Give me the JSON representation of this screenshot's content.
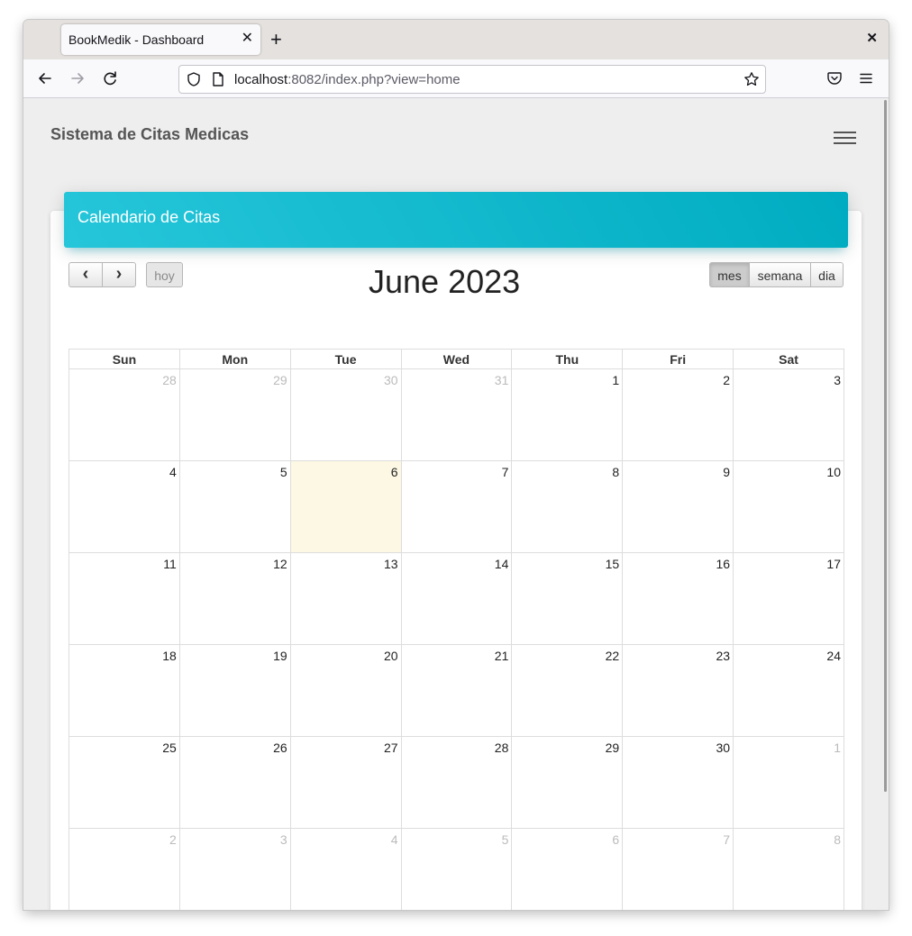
{
  "browser": {
    "tab_title": "BookMedik - Dashboard",
    "tab_close": "✕",
    "new_tab": "+",
    "window_close": "✕",
    "url_host": "localhost",
    "url_rest": ":8082/index.php?view=home"
  },
  "app": {
    "brand": "Sistema de Citas Medicas"
  },
  "card": {
    "title": "Calendario de Citas"
  },
  "calendar": {
    "prev_label": "‹",
    "next_label": "›",
    "today_label": "hoy",
    "title": "June 2023",
    "views": [
      "mes",
      "semana",
      "dia"
    ],
    "active_view": "mes",
    "weekdays": [
      "Sun",
      "Mon",
      "Tue",
      "Wed",
      "Thu",
      "Fri",
      "Sat"
    ],
    "today": "6",
    "weeks": [
      [
        {
          "d": "28",
          "o": true
        },
        {
          "d": "29",
          "o": true
        },
        {
          "d": "30",
          "o": true
        },
        {
          "d": "31",
          "o": true
        },
        {
          "d": "1"
        },
        {
          "d": "2"
        },
        {
          "d": "3"
        }
      ],
      [
        {
          "d": "4"
        },
        {
          "d": "5"
        },
        {
          "d": "6",
          "t": true
        },
        {
          "d": "7"
        },
        {
          "d": "8"
        },
        {
          "d": "9"
        },
        {
          "d": "10"
        }
      ],
      [
        {
          "d": "11"
        },
        {
          "d": "12"
        },
        {
          "d": "13"
        },
        {
          "d": "14"
        },
        {
          "d": "15"
        },
        {
          "d": "16"
        },
        {
          "d": "17"
        }
      ],
      [
        {
          "d": "18"
        },
        {
          "d": "19"
        },
        {
          "d": "20"
        },
        {
          "d": "21"
        },
        {
          "d": "22"
        },
        {
          "d": "23"
        },
        {
          "d": "24"
        }
      ],
      [
        {
          "d": "25"
        },
        {
          "d": "26"
        },
        {
          "d": "27"
        },
        {
          "d": "28"
        },
        {
          "d": "29"
        },
        {
          "d": "30"
        },
        {
          "d": "1",
          "o": true
        }
      ],
      [
        {
          "d": "2",
          "o": true
        },
        {
          "d": "3",
          "o": true
        },
        {
          "d": "4",
          "o": true
        },
        {
          "d": "5",
          "o": true
        },
        {
          "d": "6",
          "o": true
        },
        {
          "d": "7",
          "o": true
        },
        {
          "d": "8",
          "o": true
        }
      ]
    ]
  },
  "colors": {
    "header_gradient_start": "#26c6da",
    "header_gradient_end": "#00acc1",
    "today_bg": "#fcf8e3"
  }
}
